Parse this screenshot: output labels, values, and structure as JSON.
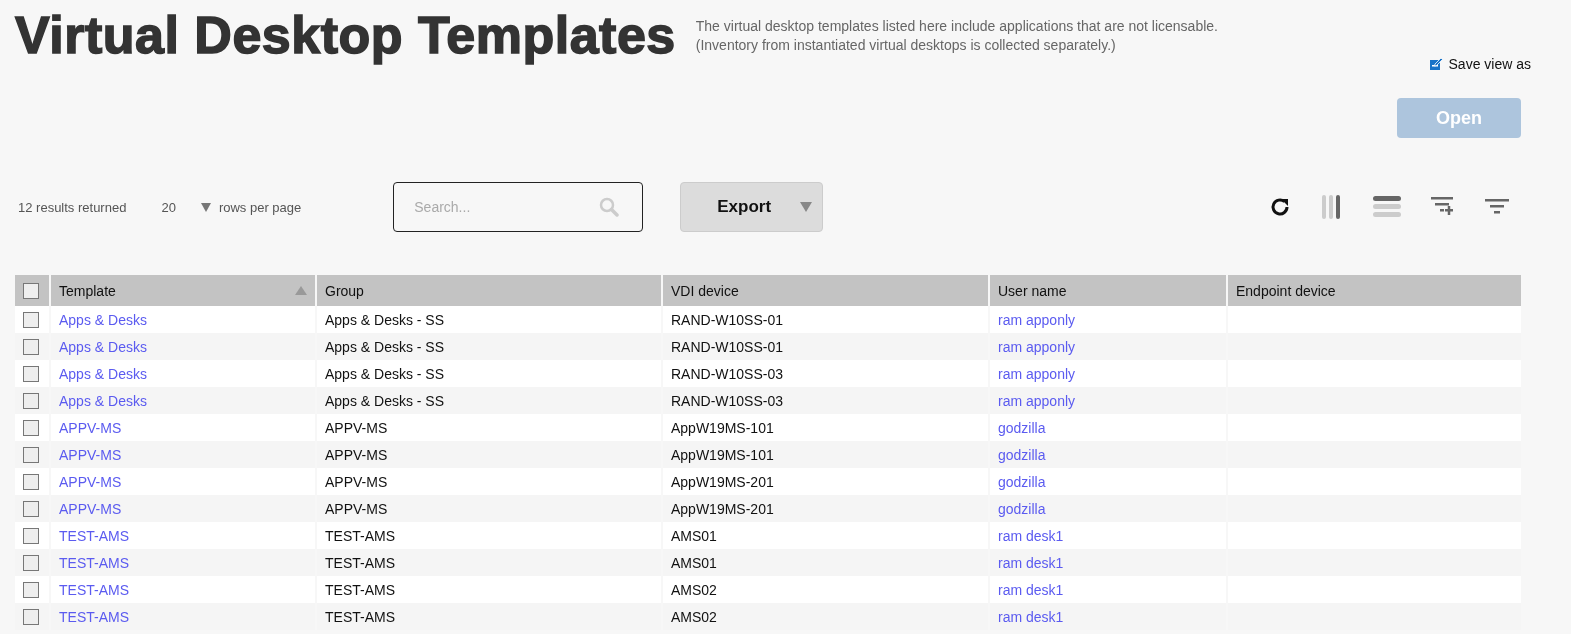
{
  "title": "Virtual Desktop Templates",
  "description": [
    "The virtual desktop templates listed here include applications that are not licensable.",
    "(Inventory from instantiated virtual desktops is collected separately.)"
  ],
  "save_view": {
    "label": "Save view as"
  },
  "open_button": {
    "label": "Open",
    "disabled": true
  },
  "toolbar": {
    "results": "12 results returned",
    "rows_per_page": {
      "value": "20",
      "label": "rows per page"
    },
    "search": {
      "placeholder": "Search..."
    },
    "export": {
      "label": "Export"
    }
  },
  "table": {
    "select_all": {
      "checked": false
    },
    "columns": [
      {
        "label": "Template",
        "sorted": true
      },
      {
        "label": "Group",
        "sorted": false
      },
      {
        "label": "VDI device",
        "sorted": false
      },
      {
        "label": "User name",
        "sorted": false
      },
      {
        "label": "Endpoint device",
        "sorted": false
      }
    ],
    "rows": [
      {
        "checked": false,
        "template": "Apps & Desks",
        "group": "Apps & Desks - SS",
        "vdi": "RAND-W10SS-01",
        "user": "ram apponly"
      },
      {
        "checked": false,
        "template": "Apps & Desks",
        "group": "Apps & Desks - SS",
        "vdi": "RAND-W10SS-01",
        "user": "ram apponly"
      },
      {
        "checked": false,
        "template": "Apps & Desks",
        "group": "Apps & Desks - SS",
        "vdi": "RAND-W10SS-03",
        "user": "ram apponly"
      },
      {
        "checked": false,
        "template": "Apps & Desks",
        "group": "Apps & Desks - SS",
        "vdi": "RAND-W10SS-03",
        "user": "ram apponly"
      },
      {
        "checked": false,
        "template": "APPV-MS",
        "group": "APPV-MS",
        "vdi": "AppW19MS-101",
        "user": "godzilla"
      },
      {
        "checked": false,
        "template": "APPV-MS",
        "group": "APPV-MS",
        "vdi": "AppW19MS-101",
        "user": "godzilla"
      },
      {
        "checked": false,
        "template": "APPV-MS",
        "group": "APPV-MS",
        "vdi": "AppW19MS-201",
        "user": "godzilla"
      },
      {
        "checked": false,
        "template": "APPV-MS",
        "group": "APPV-MS",
        "vdi": "AppW19MS-201",
        "user": "godzilla"
      },
      {
        "checked": false,
        "template": "TEST-AMS",
        "group": "TEST-AMS",
        "vdi": "AMS01",
        "user": "ram desk1"
      },
      {
        "checked": false,
        "template": "TEST-AMS",
        "group": "TEST-AMS",
        "vdi": "AMS01",
        "user": "ram desk1"
      },
      {
        "checked": false,
        "template": "TEST-AMS",
        "group": "TEST-AMS",
        "vdi": "AMS02",
        "user": "ram desk1"
      },
      {
        "checked": false,
        "template": "TEST-AMS",
        "group": "TEST-AMS",
        "vdi": "AMS02",
        "user": "ram desk1"
      }
    ]
  }
}
